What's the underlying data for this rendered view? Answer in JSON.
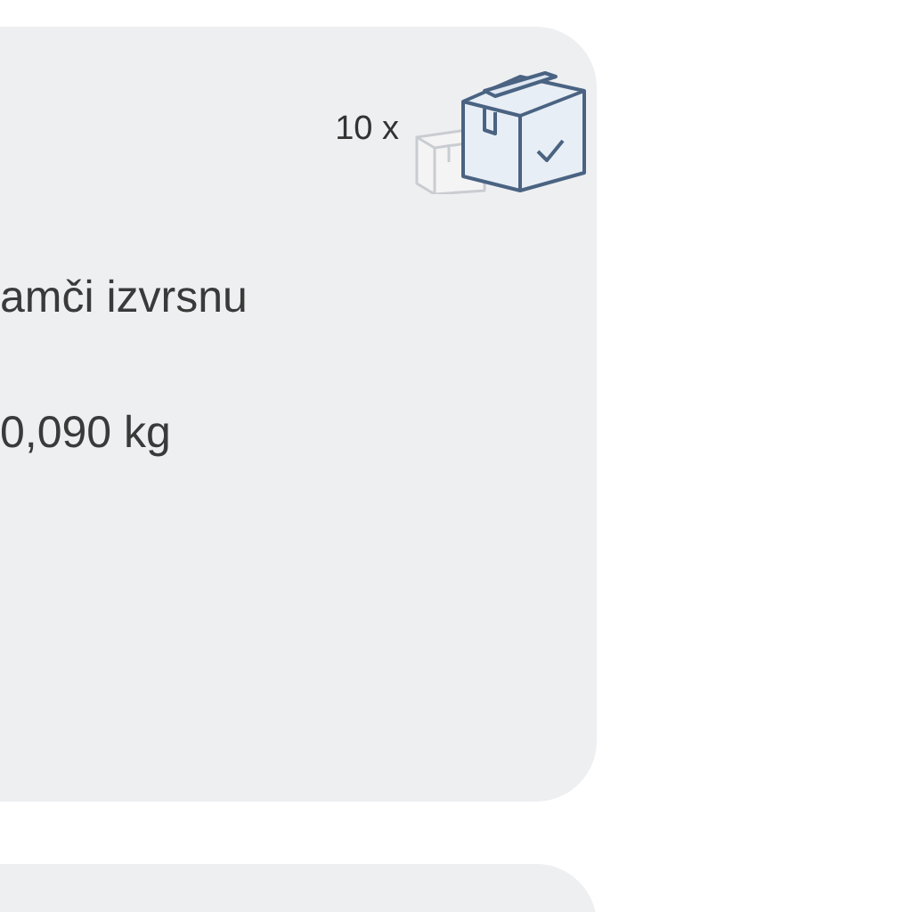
{
  "cards": [
    {
      "kind": "full",
      "quantity": "10 x",
      "lines": [
        "amči izvrsnu",
        "0,090 kg"
      ]
    },
    {
      "kind": "partial"
    }
  ]
}
